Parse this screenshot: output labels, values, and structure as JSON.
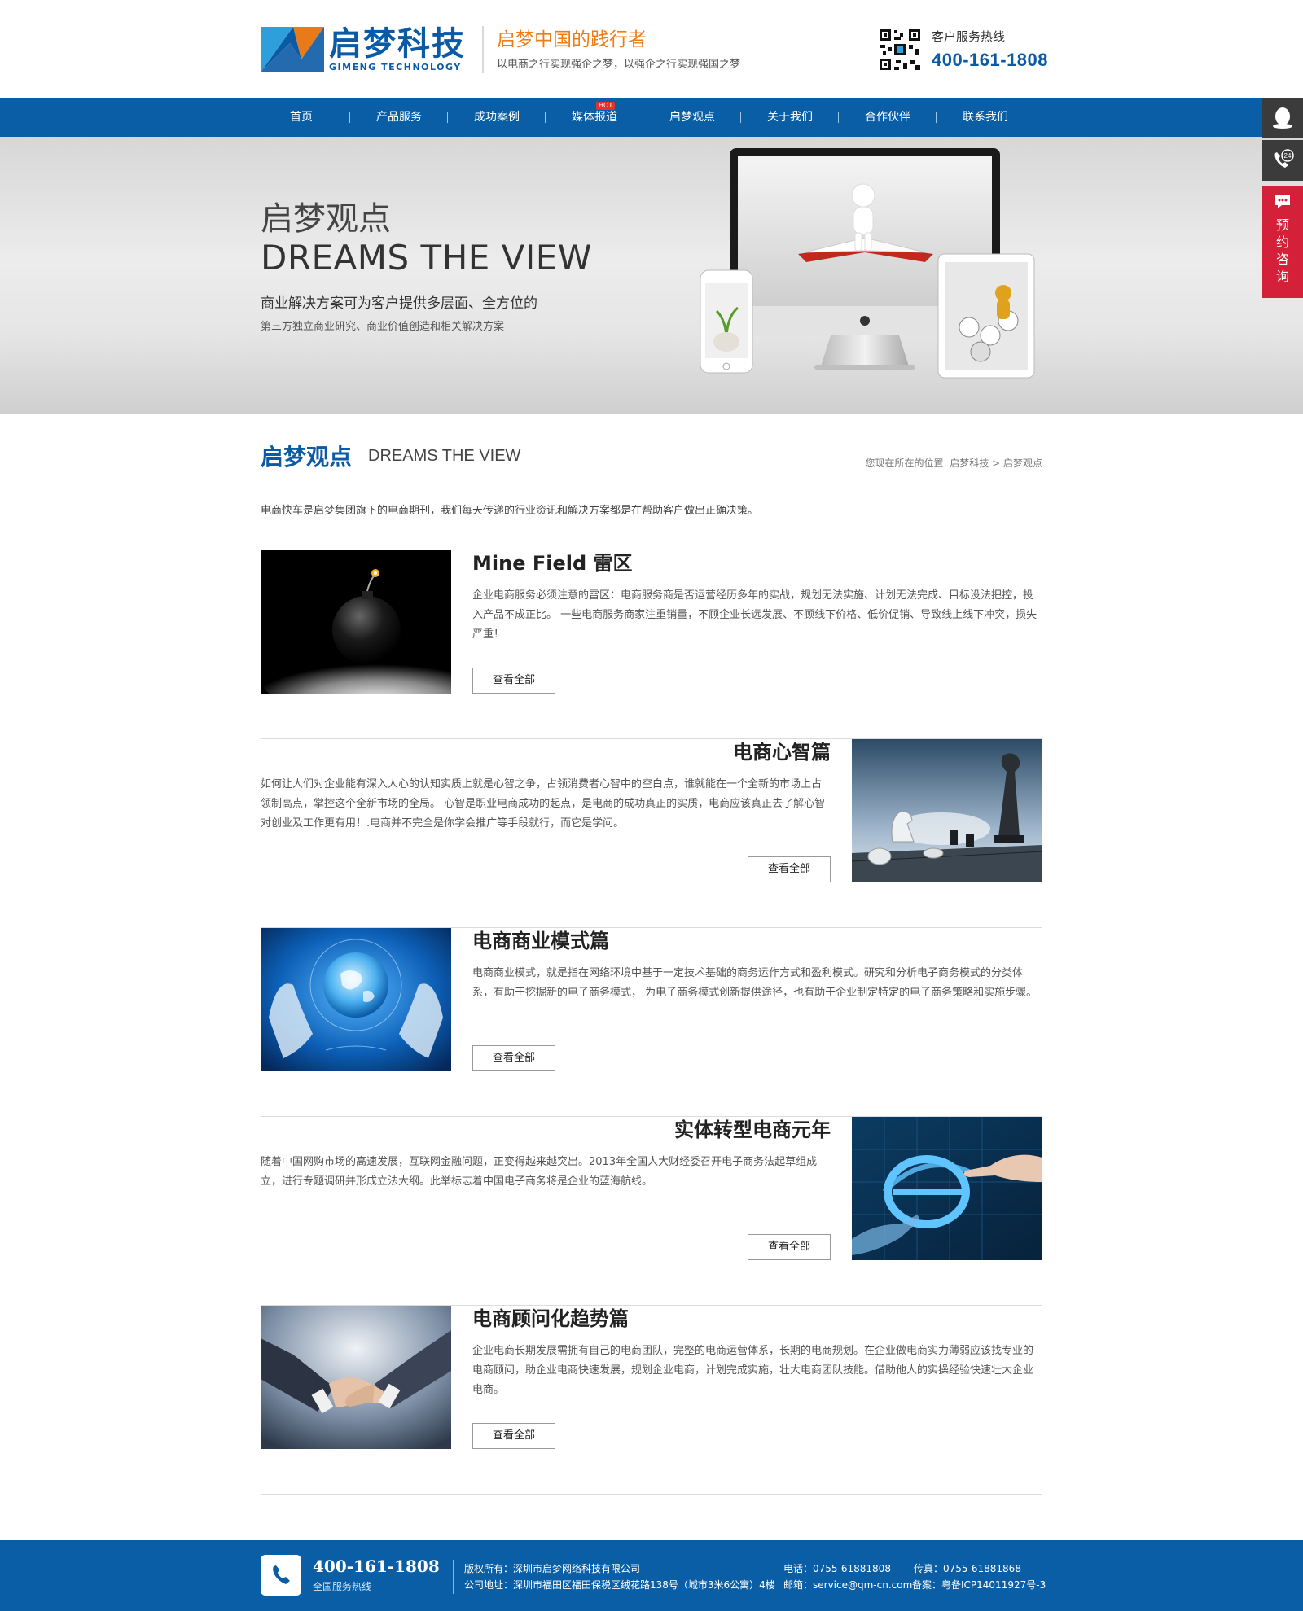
{
  "brand": {
    "name_cn": "启梦科技",
    "name_en": "GIMENG TECHNOLOGY",
    "slogan": "启梦中国的践行者",
    "slogan_sub": "以电商之行实现强企之梦，以强企之行实现强国之梦",
    "hotline_label": "客户服务热线",
    "hotline": "400-161-1808"
  },
  "nav": {
    "items": [
      "首页",
      "产品服务",
      "成功案例",
      "媒体报道",
      "启梦观点",
      "关于我们",
      "合作伙伴",
      "联系我们"
    ],
    "hot_badge": "HOT"
  },
  "side": {
    "phone_badge": "24",
    "consult": "预约咨询"
  },
  "banner": {
    "title_cn": "启梦观点",
    "title_en": "DREAMS THE VIEW",
    "desc": "商业解决方案可为客户提供多层面、全方位的",
    "sub": "第三方独立商业研究、商业价值创造和相关解决方案"
  },
  "section": {
    "title_cn": "启梦观点",
    "title_en": "DREAMS THE VIEW",
    "breadcrumb": "您现在所在的位置: 启梦科技 > 启梦观点",
    "intro": "电商快车是启梦集团旗下的电商期刊，我们每天传递的行业资讯和解决方案都是在帮助客户做出正确决策。"
  },
  "articles": [
    {
      "title": "Mine Field 雷区",
      "text": "企业电商服务必须注意的雷区：电商服务商是否运营经历多年的实战，规划无法实施、计划无法完成、目标没法把控，投入产品不成正比。 一些电商服务商家注重销量，不顾企业长远发展、不顾线下价格、低价促销、导致线上线下冲突，损失严重！",
      "more": "查看全部"
    },
    {
      "title": "电商心智篇",
      "text": "如何让人们对企业能有深入人心的认知实质上就是心智之争，占领消费者心智中的空白点，谁就能在一个全新的市场上占领制高点，掌控这个全新市场的全局。 心智是职业电商成功的起点，是电商的成功真正的实质，电商应该真正去了解心智对创业及工作更有用！.电商并不完全是你学会推广等手段就行，而它是学问。",
      "more": "查看全部"
    },
    {
      "title": "电商商业模式篇",
      "text": "电商商业模式，就是指在网络环境中基于一定技术基础的商务运作方式和盈利模式。研究和分析电子商务模式的分类体系，有助于挖掘新的电子商务模式， 为电子商务模式创新提供途径，也有助于企业制定特定的电子商务策略和实施步骤。",
      "more": "查看全部"
    },
    {
      "title": "实体转型电商元年",
      "text": "随着中国网购市场的高速发展，互联网金融问题，正变得越来越突出。2013年全国人大财经委召开电子商务法起草组成立，进行专题调研并形成立法大纲。此举标志着中国电子商务将是企业的蓝海航线。",
      "more": "查看全部"
    },
    {
      "title": "电商顾问化趋势篇",
      "text": "企业电商长期发展需拥有自己的电商团队，完整的电商运营体系，长期的电商规划。在企业做电商实力薄弱应该找专业的电商顾问，助企业电商快速发展，规划企业电商，计划完成实施，壮大电商团队技能。借助他人的实操经验快速壮大企业电商。",
      "more": "查看全部"
    }
  ],
  "footer": {
    "phone": "400-161-1808",
    "phone_label": "全国服务热线",
    "copyright": "版权所有：深圳市启梦网络科技有限公司",
    "address": "公司地址：深圳市福田区福田保税区绒花路138号（城市3米6公寓）4楼",
    "tel": "电话：0755-61881808",
    "fax": "传真：0755-61881868",
    "email": "邮箱：service@qm-cn.com",
    "icp": "备案：粤备ICP14011927号-3"
  },
  "colors": {
    "primary": "#0a5ea5",
    "accent_orange": "#ef7d16",
    "consult_red": "#d5203a"
  }
}
